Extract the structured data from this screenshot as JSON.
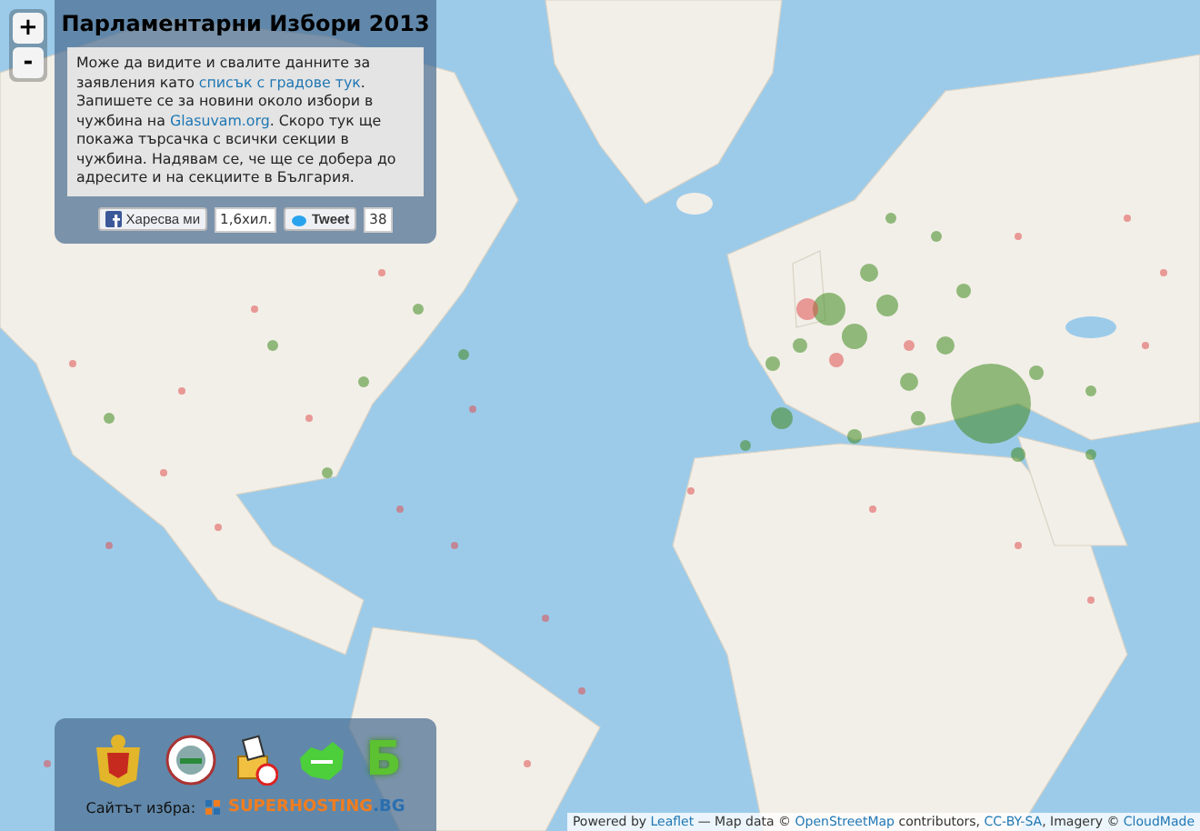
{
  "zoom_controls": [
    {
      "label": "+"
    },
    {
      "label": "-"
    }
  ],
  "info_panel": {
    "title": "Парламентарни Избори 2013",
    "description": [
      {
        "text": "Може да видите и свалите данните за заявления като ",
        "link": false
      },
      {
        "text": "списък с градове тук",
        "link": true
      },
      {
        "text": ". Запишете се за новини около избори в чужбина на ",
        "link": false
      },
      {
        "text": "Glasuvam.org",
        "link": true
      },
      {
        "text": ". Скоро тук ще покажа търсачка с всички секции в чужбина. Надявам се, че ще се добера до адресите и на секциите в България.",
        "link": false
      }
    ],
    "like_button": "Харесва ми",
    "like_count": "1,6хил.",
    "tweet_button": "Tweet",
    "tweet_count": "38"
  },
  "footer_panel": {
    "logo_letter": "Б",
    "sponsor_label": "Сайтът избра:",
    "sponsor_name": "SUPERHOSTING",
    "sponsor_suffix": ".BG"
  },
  "attribution": [
    {
      "text": "Powered by ",
      "link": false
    },
    {
      "text": "Leaflet",
      "link": true
    },
    {
      "text": " — Map data © ",
      "link": false
    },
    {
      "text": "OpenStreetMap",
      "link": true
    },
    {
      "text": " contributors, ",
      "link": false
    },
    {
      "text": "CC-BY-SA",
      "link": true
    },
    {
      "text": ", Imagery © ",
      "link": false
    },
    {
      "text": "CloudMade",
      "link": true
    }
  ]
}
